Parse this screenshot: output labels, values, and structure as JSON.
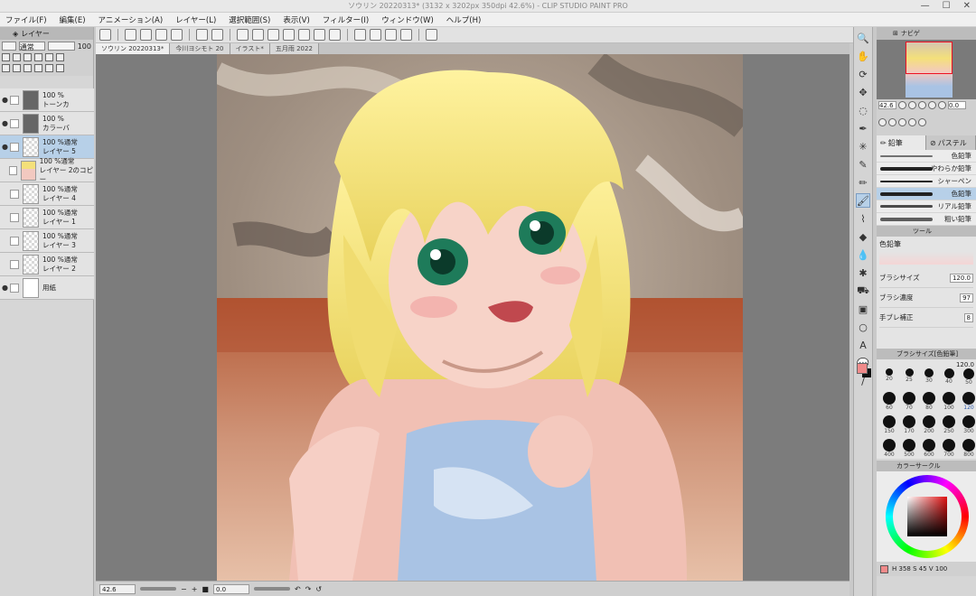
{
  "window": {
    "title": "ソウリン  20220313* (3132 x 3202px 350dpi 42.6%) - CLIP STUDIO PAINT PRO",
    "controls": [
      "—",
      "☐",
      "✕"
    ]
  },
  "menu": [
    "ファイル(F)",
    "編集(E)",
    "アニメーション(A)",
    "レイヤー(L)",
    "選択範囲(S)",
    "表示(V)",
    "フィルター(I)",
    "ウィンドウ(W)",
    "ヘルプ(H)"
  ],
  "layer_panel": {
    "tab_label": "レイヤー",
    "blend_mode": "通常",
    "opacity": "100",
    "layers": [
      {
        "percent": "100 %",
        "name": "トーンカ",
        "thumb": "dark",
        "visible": true,
        "selected": false
      },
      {
        "percent": "100 %",
        "name": "カラーバ",
        "thumb": "dark",
        "visible": true,
        "selected": false
      },
      {
        "percent": "100 %通常",
        "name": "レイヤー 5",
        "thumb": "check",
        "visible": true,
        "selected": true
      },
      {
        "percent": "100 %通常",
        "name": "レイヤー 2のコピー",
        "thumb": "girl",
        "visible": false,
        "selected": false
      },
      {
        "percent": "100 %通常",
        "name": "レイヤー 4",
        "thumb": "check",
        "visible": false,
        "selected": false
      },
      {
        "percent": "100 %通常",
        "name": "レイヤー 1",
        "thumb": "check",
        "visible": false,
        "selected": false
      },
      {
        "percent": "100 %通常",
        "name": "レイヤー 3",
        "thumb": "check",
        "visible": false,
        "selected": false
      },
      {
        "percent": "100 %通常",
        "name": "レイヤー 2",
        "thumb": "check",
        "visible": false,
        "selected": false
      },
      {
        "percent": "",
        "name": "用紙",
        "thumb": "white",
        "visible": true,
        "selected": false
      }
    ]
  },
  "doc_tabs": [
    {
      "label": "ソウリン 20220313*",
      "active": true
    },
    {
      "label": "今川ヨシモト 20",
      "active": false
    },
    {
      "label": "イラスト*",
      "active": false
    },
    {
      "label": "五月雨 2022",
      "active": false
    }
  ],
  "status": {
    "zoom": "42.6",
    "angle": "0.0"
  },
  "navigator": {
    "tab_label": "ナビゲ",
    "zoom": "42.6",
    "angle": "0.0"
  },
  "brush_tabs": [
    "鉛筆",
    "パステル"
  ],
  "brushes": [
    {
      "name": "色鉛筆",
      "selected": false,
      "partial": true
    },
    {
      "name": "やわらか鉛筆",
      "selected": false
    },
    {
      "name": "シャーペン",
      "selected": false
    },
    {
      "name": "色鉛筆",
      "selected": true
    },
    {
      "name": "リアル鉛筆",
      "selected": false
    },
    {
      "name": "粗い鉛筆",
      "selected": false
    }
  ],
  "tool_property": {
    "header": "ツール",
    "title": "色鉛筆",
    "rows": [
      {
        "label": "ブラシサイズ",
        "value": "120.0"
      },
      {
        "label": "ブラシ濃度",
        "value": "97"
      },
      {
        "label": "手ブレ補正",
        "value": "8"
      }
    ]
  },
  "brush_size": {
    "header": "ブラシサイズ[色鉛筆]",
    "current": "120.0",
    "sizes": [
      "20",
      "25",
      "30",
      "40",
      "50",
      "60",
      "70",
      "80",
      "100",
      "120",
      "150",
      "170",
      "200",
      "250",
      "300",
      "400",
      "500",
      "600",
      "700",
      "800"
    ],
    "selected": "120"
  },
  "color": {
    "header": "カラーサークル",
    "main_color": "#f08a8a",
    "sub_color": "#111111",
    "footer": "H 358  S 45  V 100"
  }
}
